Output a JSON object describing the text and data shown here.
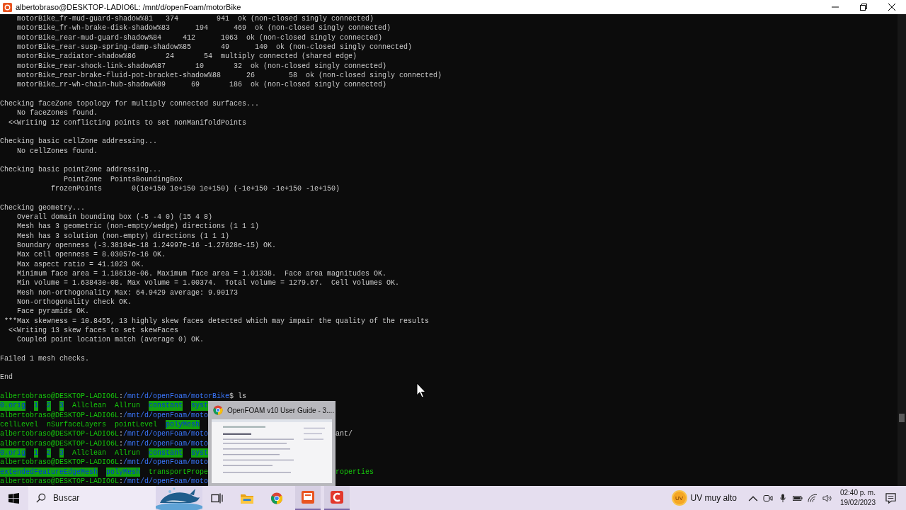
{
  "window": {
    "title": "albertobraso@DESKTOP-LADIO6L: /mnt/d/openFoam/motorBike"
  },
  "terminal": {
    "lines": [
      {
        "kind": "line",
        "segments": [
          {
            "kind": "out",
            "text": "    motorBike_fr-mud-guard-shadow%81   374         941  ok (non-closed singly connected)"
          }
        ]
      },
      {
        "kind": "line",
        "segments": [
          {
            "kind": "out",
            "text": "    motorBike_fr-wh-brake-disk-shadow%83      194      469  ok (non-closed singly connected)"
          }
        ]
      },
      {
        "kind": "line",
        "segments": [
          {
            "kind": "out",
            "text": "    motorBike_rear-mud-guard-shadow%84     412      1063  ok (non-closed singly connected)"
          }
        ]
      },
      {
        "kind": "line",
        "segments": [
          {
            "kind": "out",
            "text": "    motorBike_rear-susp-spring-damp-shadow%85       49      140  ok (non-closed singly connected)"
          }
        ]
      },
      {
        "kind": "line",
        "segments": [
          {
            "kind": "out",
            "text": "    motorBike_radiator-shadow%86       24       54  multiply connected (shared edge)"
          }
        ]
      },
      {
        "kind": "line",
        "segments": [
          {
            "kind": "out",
            "text": "    motorBike_rear-shock-link-shadow%87       10       32  ok (non-closed singly connected)"
          }
        ]
      },
      {
        "kind": "line",
        "segments": [
          {
            "kind": "out",
            "text": "    motorBike_rear-brake-fluid-pot-bracket-shadow%88      26        58  ok (non-closed singly connected)"
          }
        ]
      },
      {
        "kind": "line",
        "segments": [
          {
            "kind": "out",
            "text": "    motorBike_rr-wh-chain-hub-shadow%89      69       186  ok (non-closed singly connected)"
          }
        ]
      },
      {
        "kind": "blank"
      },
      {
        "kind": "line",
        "segments": [
          {
            "kind": "out",
            "text": "Checking faceZone topology for multiply connected surfaces..."
          }
        ]
      },
      {
        "kind": "line",
        "segments": [
          {
            "kind": "out",
            "text": "    No faceZones found."
          }
        ]
      },
      {
        "kind": "line",
        "segments": [
          {
            "kind": "out",
            "text": "  <<Writing 12 conflicting points to set nonManifoldPoints"
          }
        ]
      },
      {
        "kind": "blank"
      },
      {
        "kind": "line",
        "segments": [
          {
            "kind": "out",
            "text": "Checking basic cellZone addressing..."
          }
        ]
      },
      {
        "kind": "line",
        "segments": [
          {
            "kind": "out",
            "text": "    No cellZones found."
          }
        ]
      },
      {
        "kind": "blank"
      },
      {
        "kind": "line",
        "segments": [
          {
            "kind": "out",
            "text": "Checking basic pointZone addressing..."
          }
        ]
      },
      {
        "kind": "line",
        "segments": [
          {
            "kind": "out",
            "text": "               PointZone  PointsBoundingBox"
          }
        ]
      },
      {
        "kind": "line",
        "segments": [
          {
            "kind": "out",
            "text": "            frozenPoints       0(1e+150 1e+150 1e+150) (-1e+150 -1e+150 -1e+150)"
          }
        ]
      },
      {
        "kind": "blank"
      },
      {
        "kind": "line",
        "segments": [
          {
            "kind": "out",
            "text": "Checking geometry..."
          }
        ]
      },
      {
        "kind": "line",
        "segments": [
          {
            "kind": "out",
            "text": "    Overall domain bounding box (-5 -4 0) (15 4 8)"
          }
        ]
      },
      {
        "kind": "line",
        "segments": [
          {
            "kind": "out",
            "text": "    Mesh has 3 geometric (non-empty/wedge) directions (1 1 1)"
          }
        ]
      },
      {
        "kind": "line",
        "segments": [
          {
            "kind": "out",
            "text": "    Mesh has 3 solution (non-empty) directions (1 1 1)"
          }
        ]
      },
      {
        "kind": "line",
        "segments": [
          {
            "kind": "out",
            "text": "    Boundary openness (-3.38104e-18 1.24997e-16 -1.27628e-15) OK."
          }
        ]
      },
      {
        "kind": "line",
        "segments": [
          {
            "kind": "out",
            "text": "    Max cell openness = 8.03057e-16 OK."
          }
        ]
      },
      {
        "kind": "line",
        "segments": [
          {
            "kind": "out",
            "text": "    Max aspect ratio = 41.1023 OK."
          }
        ]
      },
      {
        "kind": "line",
        "segments": [
          {
            "kind": "out",
            "text": "    Minimum face area = 1.18613e-06. Maximum face area = 1.01338.  Face area magnitudes OK."
          }
        ]
      },
      {
        "kind": "line",
        "segments": [
          {
            "kind": "out",
            "text": "    Min volume = 1.63843e-08. Max volume = 1.00374.  Total volume = 1279.67.  Cell volumes OK."
          }
        ]
      },
      {
        "kind": "line",
        "segments": [
          {
            "kind": "out",
            "text": "    Mesh non-orthogonality Max: 64.9429 average: 9.90173"
          }
        ]
      },
      {
        "kind": "line",
        "segments": [
          {
            "kind": "out",
            "text": "    Non-orthogonality check OK."
          }
        ]
      },
      {
        "kind": "line",
        "segments": [
          {
            "kind": "out",
            "text": "    Face pyramids OK."
          }
        ]
      },
      {
        "kind": "line",
        "segments": [
          {
            "kind": "out",
            "text": " ***Max skewness = 10.8455, 13 highly skew faces detected which may impair the quality of the results"
          }
        ]
      },
      {
        "kind": "line",
        "segments": [
          {
            "kind": "out",
            "text": "  <<Writing 13 skew faces to set skewFaces"
          }
        ]
      },
      {
        "kind": "line",
        "segments": [
          {
            "kind": "out",
            "text": "    Coupled point location match (average 0) OK."
          }
        ]
      },
      {
        "kind": "blank"
      },
      {
        "kind": "line",
        "segments": [
          {
            "kind": "out",
            "text": "Failed 1 mesh checks."
          }
        ]
      },
      {
        "kind": "blank"
      },
      {
        "kind": "line",
        "segments": [
          {
            "kind": "out",
            "text": "End"
          }
        ]
      },
      {
        "kind": "blank"
      },
      {
        "kind": "line",
        "segments": [
          {
            "kind": "user",
            "text": "albertobraso@DESKTOP-LADIO6L"
          },
          {
            "kind": "symbol",
            "text": ":"
          },
          {
            "kind": "path",
            "text": "/mnt/d/openFoam/motorBike"
          },
          {
            "kind": "command",
            "text": "$ ls"
          }
        ]
      },
      {
        "kind": "listing",
        "segments": [
          {
            "kind": "dir",
            "text": "0.orig"
          },
          {
            "kind": "dir",
            "text": "1"
          },
          {
            "kind": "dir",
            "text": "2"
          },
          {
            "kind": "dir",
            "text": "3"
          },
          {
            "kind": "file",
            "text": "Allclean"
          },
          {
            "kind": "file",
            "text": "Allrun"
          },
          {
            "kind": "dir",
            "text": "constant"
          },
          {
            "kind": "dir",
            "text": "syst"
          }
        ]
      },
      {
        "kind": "line",
        "segments": [
          {
            "kind": "user",
            "text": "albertobraso@DESKTOP-LADIO6L"
          },
          {
            "kind": "symbol",
            "text": ":"
          },
          {
            "kind": "path",
            "text": "/mnt/d/openFoam/moto"
          }
        ]
      },
      {
        "kind": "listing",
        "segments": [
          {
            "kind": "file",
            "text": "cellLevel"
          },
          {
            "kind": "file",
            "text": "nSurfaceLayers"
          },
          {
            "kind": "file",
            "text": "pointLevel"
          },
          {
            "kind": "dir",
            "text": "polyMesh"
          }
        ]
      },
      {
        "kind": "line",
        "segments": [
          {
            "kind": "user",
            "text": "albertobraso@DESKTOP-LADIO6L"
          },
          {
            "kind": "symbol",
            "text": ":"
          },
          {
            "kind": "path",
            "text": "/mnt/d/openFoam/moto"
          }
        ],
        "tail": {
          "kind": "command",
          "text": "ant/"
        }
      },
      {
        "kind": "line",
        "segments": [
          {
            "kind": "user",
            "text": "albertobraso@DESKTOP-LADIO6L"
          },
          {
            "kind": "symbol",
            "text": ":"
          },
          {
            "kind": "path",
            "text": "/mnt/d/openFoam/moto"
          }
        ]
      },
      {
        "kind": "listing",
        "segments": [
          {
            "kind": "dir",
            "text": "0.orig"
          },
          {
            "kind": "dir",
            "text": "1"
          },
          {
            "kind": "dir",
            "text": "2"
          },
          {
            "kind": "dir",
            "text": "3"
          },
          {
            "kind": "file",
            "text": "Allclean"
          },
          {
            "kind": "file",
            "text": "Allrun"
          },
          {
            "kind": "dir",
            "text": "constant"
          },
          {
            "kind": "dir",
            "text": "syst"
          }
        ]
      },
      {
        "kind": "line",
        "segments": [
          {
            "kind": "user",
            "text": "albertobraso@DESKTOP-LADIO6L"
          },
          {
            "kind": "symbol",
            "text": ":"
          },
          {
            "kind": "path",
            "text": "/mnt/d/openFoam/moto"
          }
        ]
      },
      {
        "kind": "listing",
        "segments": [
          {
            "kind": "dir",
            "text": "extendedFeatureEdgeMesh"
          },
          {
            "kind": "dir",
            "text": "polyMesh"
          },
          {
            "kind": "file",
            "text": "transportPrope"
          }
        ],
        "tail": {
          "kind": "file",
          "text": "roperties"
        }
      },
      {
        "kind": "line",
        "segments": [
          {
            "kind": "user",
            "text": "albertobraso@DESKTOP-LADIO6L"
          },
          {
            "kind": "symbol",
            "text": ":"
          },
          {
            "kind": "path",
            "text": "/mnt/d/openFoam/moto"
          }
        ]
      }
    ]
  },
  "preview": {
    "title": "OpenFOAM v10 User Guide - 3...."
  },
  "taskbar": {
    "search": {
      "placeholder": "Buscar"
    },
    "weather": {
      "badge": "UV",
      "text": "UV muy alto"
    },
    "clock": {
      "time": "02:40 p. m.",
      "date": "19/02/2023"
    }
  }
}
